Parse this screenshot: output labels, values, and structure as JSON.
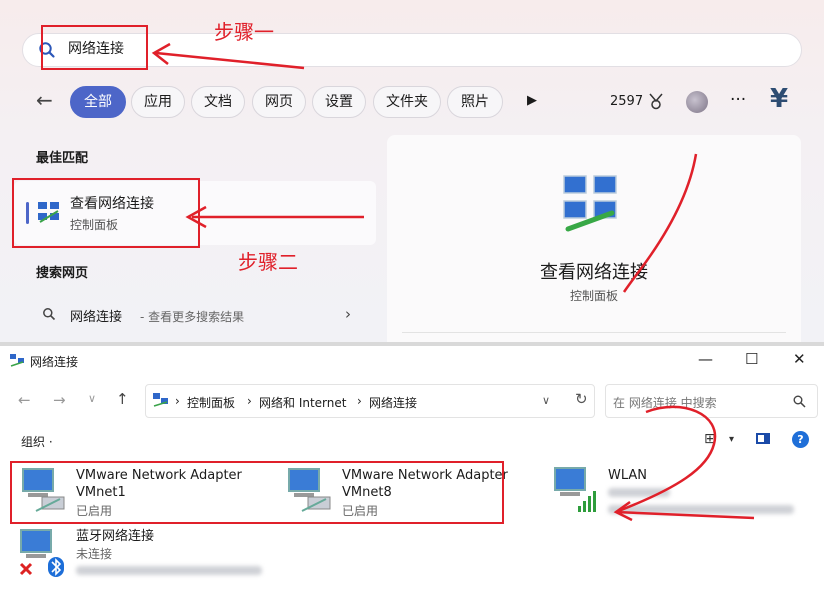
{
  "search": {
    "query": "网络连接",
    "step1": "步骤一",
    "step2": "步骤二",
    "filters": [
      "全部",
      "应用",
      "文档",
      "网页",
      "设置",
      "文件夹",
      "照片"
    ],
    "points": "2597",
    "currency_icon": "¥",
    "best_match_header": "最佳匹配",
    "result": {
      "title": "查看网络连接",
      "subtitle": "控制面板"
    },
    "web_header": "搜索网页",
    "web_item": {
      "query": "网络连接",
      "more": " - 查看更多搜索结果"
    },
    "preview": {
      "title": "查看网络连接",
      "subtitle": "控制面板"
    }
  },
  "explorer": {
    "window_title": "网络连接",
    "breadcrumbs": [
      "控制面板",
      "网络和 Internet",
      "网络连接"
    ],
    "search_placeholder": "在 网络连接 中搜索",
    "organize": "组织 ·",
    "adapters": [
      {
        "name": "VMware Network Adapter",
        "device": "VMnet1",
        "status": "已启用"
      },
      {
        "name": "VMware Network Adapter",
        "device": "VMnet8",
        "status": "已启用"
      },
      {
        "name": "WLAN",
        "device": "",
        "status": ""
      },
      {
        "name": "蓝牙网络连接",
        "device": "",
        "status": "未连接"
      }
    ]
  },
  "colors": {
    "accent": "#4d66c8",
    "annotation": "#e0202a"
  }
}
